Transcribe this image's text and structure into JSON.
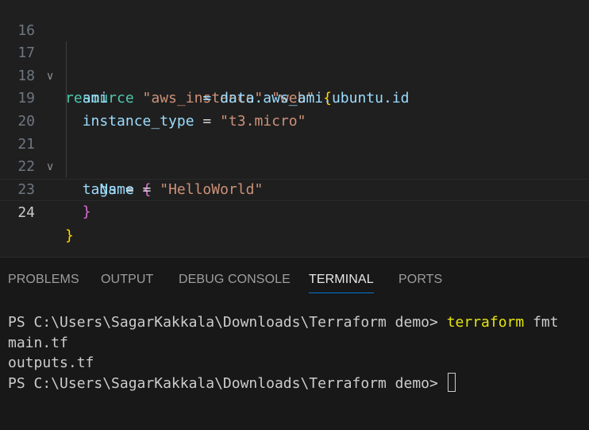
{
  "editor": {
    "lines": [
      {
        "n": "16"
      },
      {
        "n": "17",
        "t0": "resource",
        "t1": " ",
        "t2": "\"aws_instance\"",
        "t3": " ",
        "t4": "\"web\"",
        "t5": " ",
        "t6": "{"
      },
      {
        "n": "18",
        "t0": "  ",
        "t1": "ami",
        "t2": "           = data.aws_ami.ubuntu.id"
      },
      {
        "n": "19",
        "t0": "  ",
        "t1": "instance_type",
        "t2": " = ",
        "t3": "\"t3.micro\""
      },
      {
        "n": "20"
      },
      {
        "n": "21",
        "t0": "  ",
        "t1": "tags",
        "t2": " = ",
        "t3": "{"
      },
      {
        "n": "22",
        "t0": "    ",
        "t1": "Name",
        "t2": " = ",
        "t3": "\"HelloWorld\""
      },
      {
        "n": "23",
        "t0": "  ",
        "t1": "}"
      },
      {
        "n": "24",
        "t0": "}"
      }
    ],
    "fold_icon": "chevron-down-icon",
    "fold_glyph": "∨"
  },
  "panel": {
    "tabs": [
      {
        "label": "PROBLEMS"
      },
      {
        "label": "OUTPUT"
      },
      {
        "label": "DEBUG CONSOLE"
      },
      {
        "label": "TERMINAL"
      },
      {
        "label": "PORTS"
      }
    ],
    "active_tab": "TERMINAL"
  },
  "terminal": {
    "prompt": "PS C:\\Users\\SagarKakkala\\Downloads\\Terraform demo> ",
    "command": "terraform",
    "args": " fmt",
    "output": [
      "main.tf",
      "outputs.tf"
    ],
    "prompt2": "PS C:\\Users\\SagarKakkala\\Downloads\\Terraform demo> "
  },
  "colors": {
    "accent": "#0078d4",
    "background": "#1f1f1f",
    "panel_background": "#181818"
  }
}
